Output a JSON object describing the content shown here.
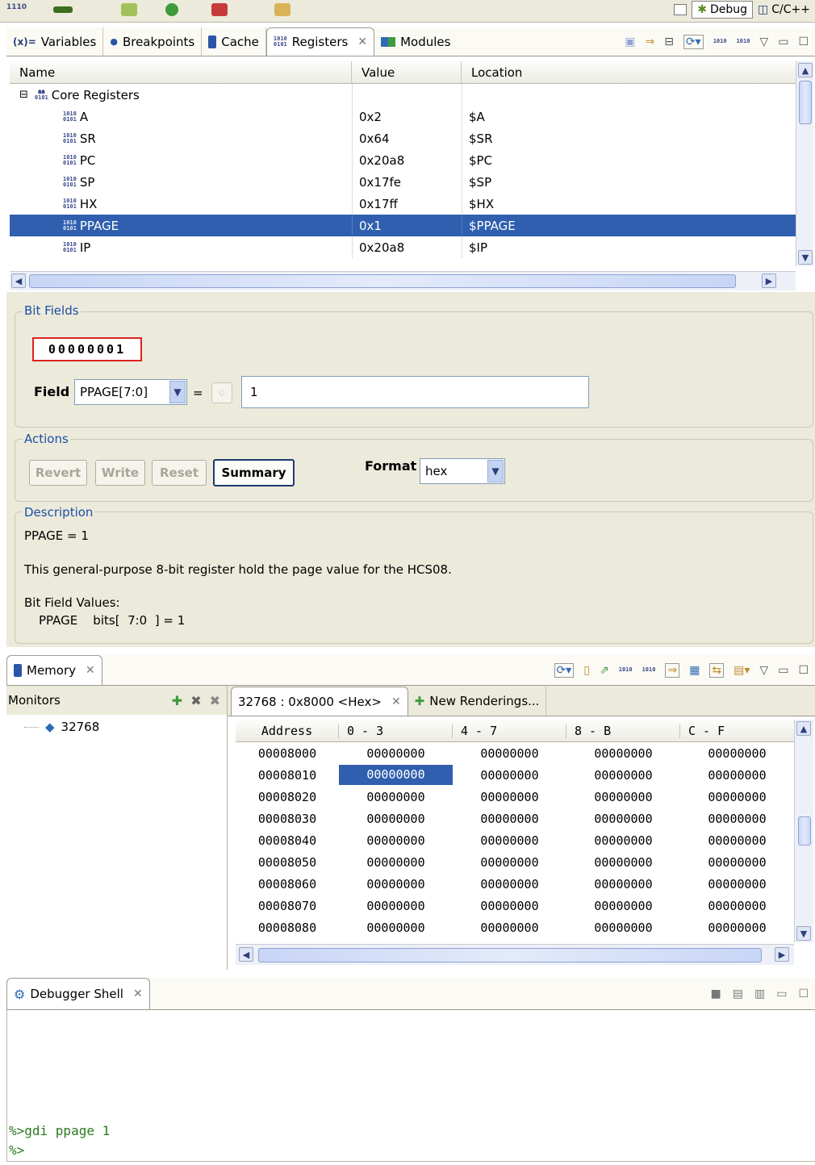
{
  "perspectives": {
    "debug": "Debug",
    "cc": "C/C++"
  },
  "registers_view": {
    "tabs": [
      {
        "label": "Variables",
        "icon": "variables-icon"
      },
      {
        "label": "Breakpoints",
        "icon": "breakpoints-icon"
      },
      {
        "label": "Cache",
        "icon": "cache-icon"
      },
      {
        "label": "Registers",
        "icon": "registers-icon"
      },
      {
        "label": "Modules",
        "icon": "modules-icon"
      }
    ],
    "columns": {
      "name": "Name",
      "value": "Value",
      "location": "Location"
    },
    "group": {
      "label": "Core Registers",
      "toggle": "⊟"
    },
    "rows": [
      {
        "name": "A",
        "value": "0x2",
        "location": "$A"
      },
      {
        "name": "SR",
        "value": "0x64",
        "location": "$SR"
      },
      {
        "name": "PC",
        "value": "0x20a8",
        "location": "$PC"
      },
      {
        "name": "SP",
        "value": "0x17fe",
        "location": "$SP"
      },
      {
        "name": "HX",
        "value": "0x17ff",
        "location": "$HX"
      },
      {
        "name": "PPAGE",
        "value": "0x1",
        "location": "$PPAGE"
      },
      {
        "name": "IP",
        "value": "0x20a8",
        "location": "$IP"
      }
    ],
    "selected_row": "PPAGE"
  },
  "bit_fields": {
    "title": "Bit Fields",
    "bits": "00000001",
    "field_label": "Field",
    "field_value": "PPAGE[7:0]",
    "equals": "=",
    "value": "1"
  },
  "actions": {
    "title": "Actions",
    "revert": "Revert",
    "write": "Write",
    "reset": "Reset",
    "summary": "Summary",
    "format_label": "Format",
    "format_value": "hex"
  },
  "description": {
    "title": "Description",
    "line1": "PPAGE = 1",
    "line2": "This general-purpose 8-bit register hold the page value for the HCS08.",
    "line3": "Bit Field Values:",
    "line4": "PPAGE    bits[  7:0  ] = 1"
  },
  "memory_view": {
    "tab": "Memory",
    "monitors_label": "Monitors",
    "monitor_item": "32768",
    "rendering_tab": "32768 : 0x8000 <Hex>",
    "new_renderings": "New Renderings...",
    "columns": [
      "Address",
      "0 - 3",
      "4 - 7",
      "8 - B",
      "C - F"
    ],
    "rows": [
      [
        "00008000",
        "00000000",
        "00000000",
        "00000000",
        "00000000"
      ],
      [
        "00008010",
        "00000000",
        "00000000",
        "00000000",
        "00000000"
      ],
      [
        "00008020",
        "00000000",
        "00000000",
        "00000000",
        "00000000"
      ],
      [
        "00008030",
        "00000000",
        "00000000",
        "00000000",
        "00000000"
      ],
      [
        "00008040",
        "00000000",
        "00000000",
        "00000000",
        "00000000"
      ],
      [
        "00008050",
        "00000000",
        "00000000",
        "00000000",
        "00000000"
      ],
      [
        "00008060",
        "00000000",
        "00000000",
        "00000000",
        "00000000"
      ],
      [
        "00008070",
        "00000000",
        "00000000",
        "00000000",
        "00000000"
      ],
      [
        "00008080",
        "00000000",
        "00000000",
        "00000000",
        "00000000"
      ]
    ]
  },
  "shell_view": {
    "tab": "Debugger Shell",
    "line1": "%>gdi ppage 1",
    "line2": "%>"
  },
  "colors": {
    "selection": "#2f5fae",
    "group_label": "#1c4fa5",
    "shell_text": "#2a7a1e"
  }
}
